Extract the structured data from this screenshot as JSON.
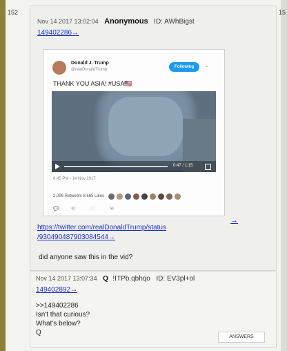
{
  "post_numbers": {
    "left": "152",
    "right": "15"
  },
  "post1": {
    "timestamp": "Nov 14 2017 13:02:04",
    "author": "Anonymous",
    "id_label": "ID: AWhBigst",
    "reply_link": "149402286→",
    "tweet": {
      "display_name": "Donald J. Trump",
      "handle": "@realDonaldTrump",
      "follow_label": "Following",
      "text": "THANK YOU ASIA! #USA🇺🇸",
      "time": "0:47 / 1:15",
      "date": "6:45 PM - 14 Nov 2017",
      "stats": "2,096 Retweets   8,665 Likes"
    },
    "expand_arrow": "→",
    "link_line1": "https://twitter.com/realDonaldTrump/status",
    "link_line2": "/930490487903084544→",
    "message": "did anyone saw this in the vid?"
  },
  "post2": {
    "timestamp": "Nov 14 2017 13:07:34",
    "author": "Q",
    "tripcode": "!ITPb.qbhqo",
    "id_label": "ID: EV3pl+ol",
    "reply_link": "149402892→",
    "lines": [
      ">>149402286",
      "Isn't that curious?",
      "What's below?",
      "Q"
    ],
    "answers_label": "ANSWERS"
  },
  "colors": {
    "accent_bar": "#8a8238",
    "link": "#1a2fcc",
    "follow_button": "#1d9bf0"
  }
}
